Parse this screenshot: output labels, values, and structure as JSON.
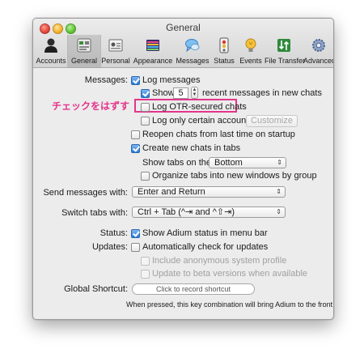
{
  "window": {
    "title": "General"
  },
  "toolbar": {
    "items": [
      {
        "label": "Accounts",
        "icon": "accounts-icon"
      },
      {
        "label": "General",
        "icon": "general-icon",
        "selected": true
      },
      {
        "label": "Personal",
        "icon": "personal-icon"
      },
      {
        "label": "Appearance",
        "icon": "appearance-icon"
      },
      {
        "label": "Messages",
        "icon": "messages-icon"
      },
      {
        "label": "Status",
        "icon": "status-icon"
      },
      {
        "label": "Events",
        "icon": "events-icon"
      },
      {
        "label": "File Transfer",
        "icon": "file-transfer-icon"
      },
      {
        "label": "Advanced",
        "icon": "advanced-icon"
      }
    ]
  },
  "messages": {
    "section_label": "Messages:",
    "log_messages": "Log messages",
    "show_label": "Show",
    "show_value": "5",
    "recent_suffix": "recent messages in new chats",
    "log_otr": "Log OTR-secured chats",
    "log_only_certain": "Log only certain accounts",
    "customize_button": "Customize",
    "reopen_chats": "Reopen chats from last time on startup",
    "create_in_tabs": "Create new chats in tabs",
    "show_tabs_on_label": "Show tabs on the:",
    "show_tabs_on_value": "Bottom",
    "organize_tabs": "Organize tabs into new windows by group"
  },
  "send": {
    "label": "Send messages with:",
    "value": "Enter and Return"
  },
  "switch_tabs": {
    "label": "Switch tabs with:",
    "value": "Ctrl + Tab (^⇥ and ^⇧⇥)"
  },
  "status": {
    "label": "Status:",
    "show_status": "Show Adium status in menu bar"
  },
  "updates": {
    "label": "Updates:",
    "auto_check": "Automatically check for updates",
    "include_profile": "Include anonymous system profile",
    "beta": "Update to beta versions when available"
  },
  "shortcut": {
    "label": "Global Shortcut:",
    "placeholder": "Click to record shortcut",
    "note": "When pressed, this key combination will bring Adium to the front"
  },
  "annotation": {
    "text": "チェックをはずす",
    "color": "#e4358b"
  }
}
